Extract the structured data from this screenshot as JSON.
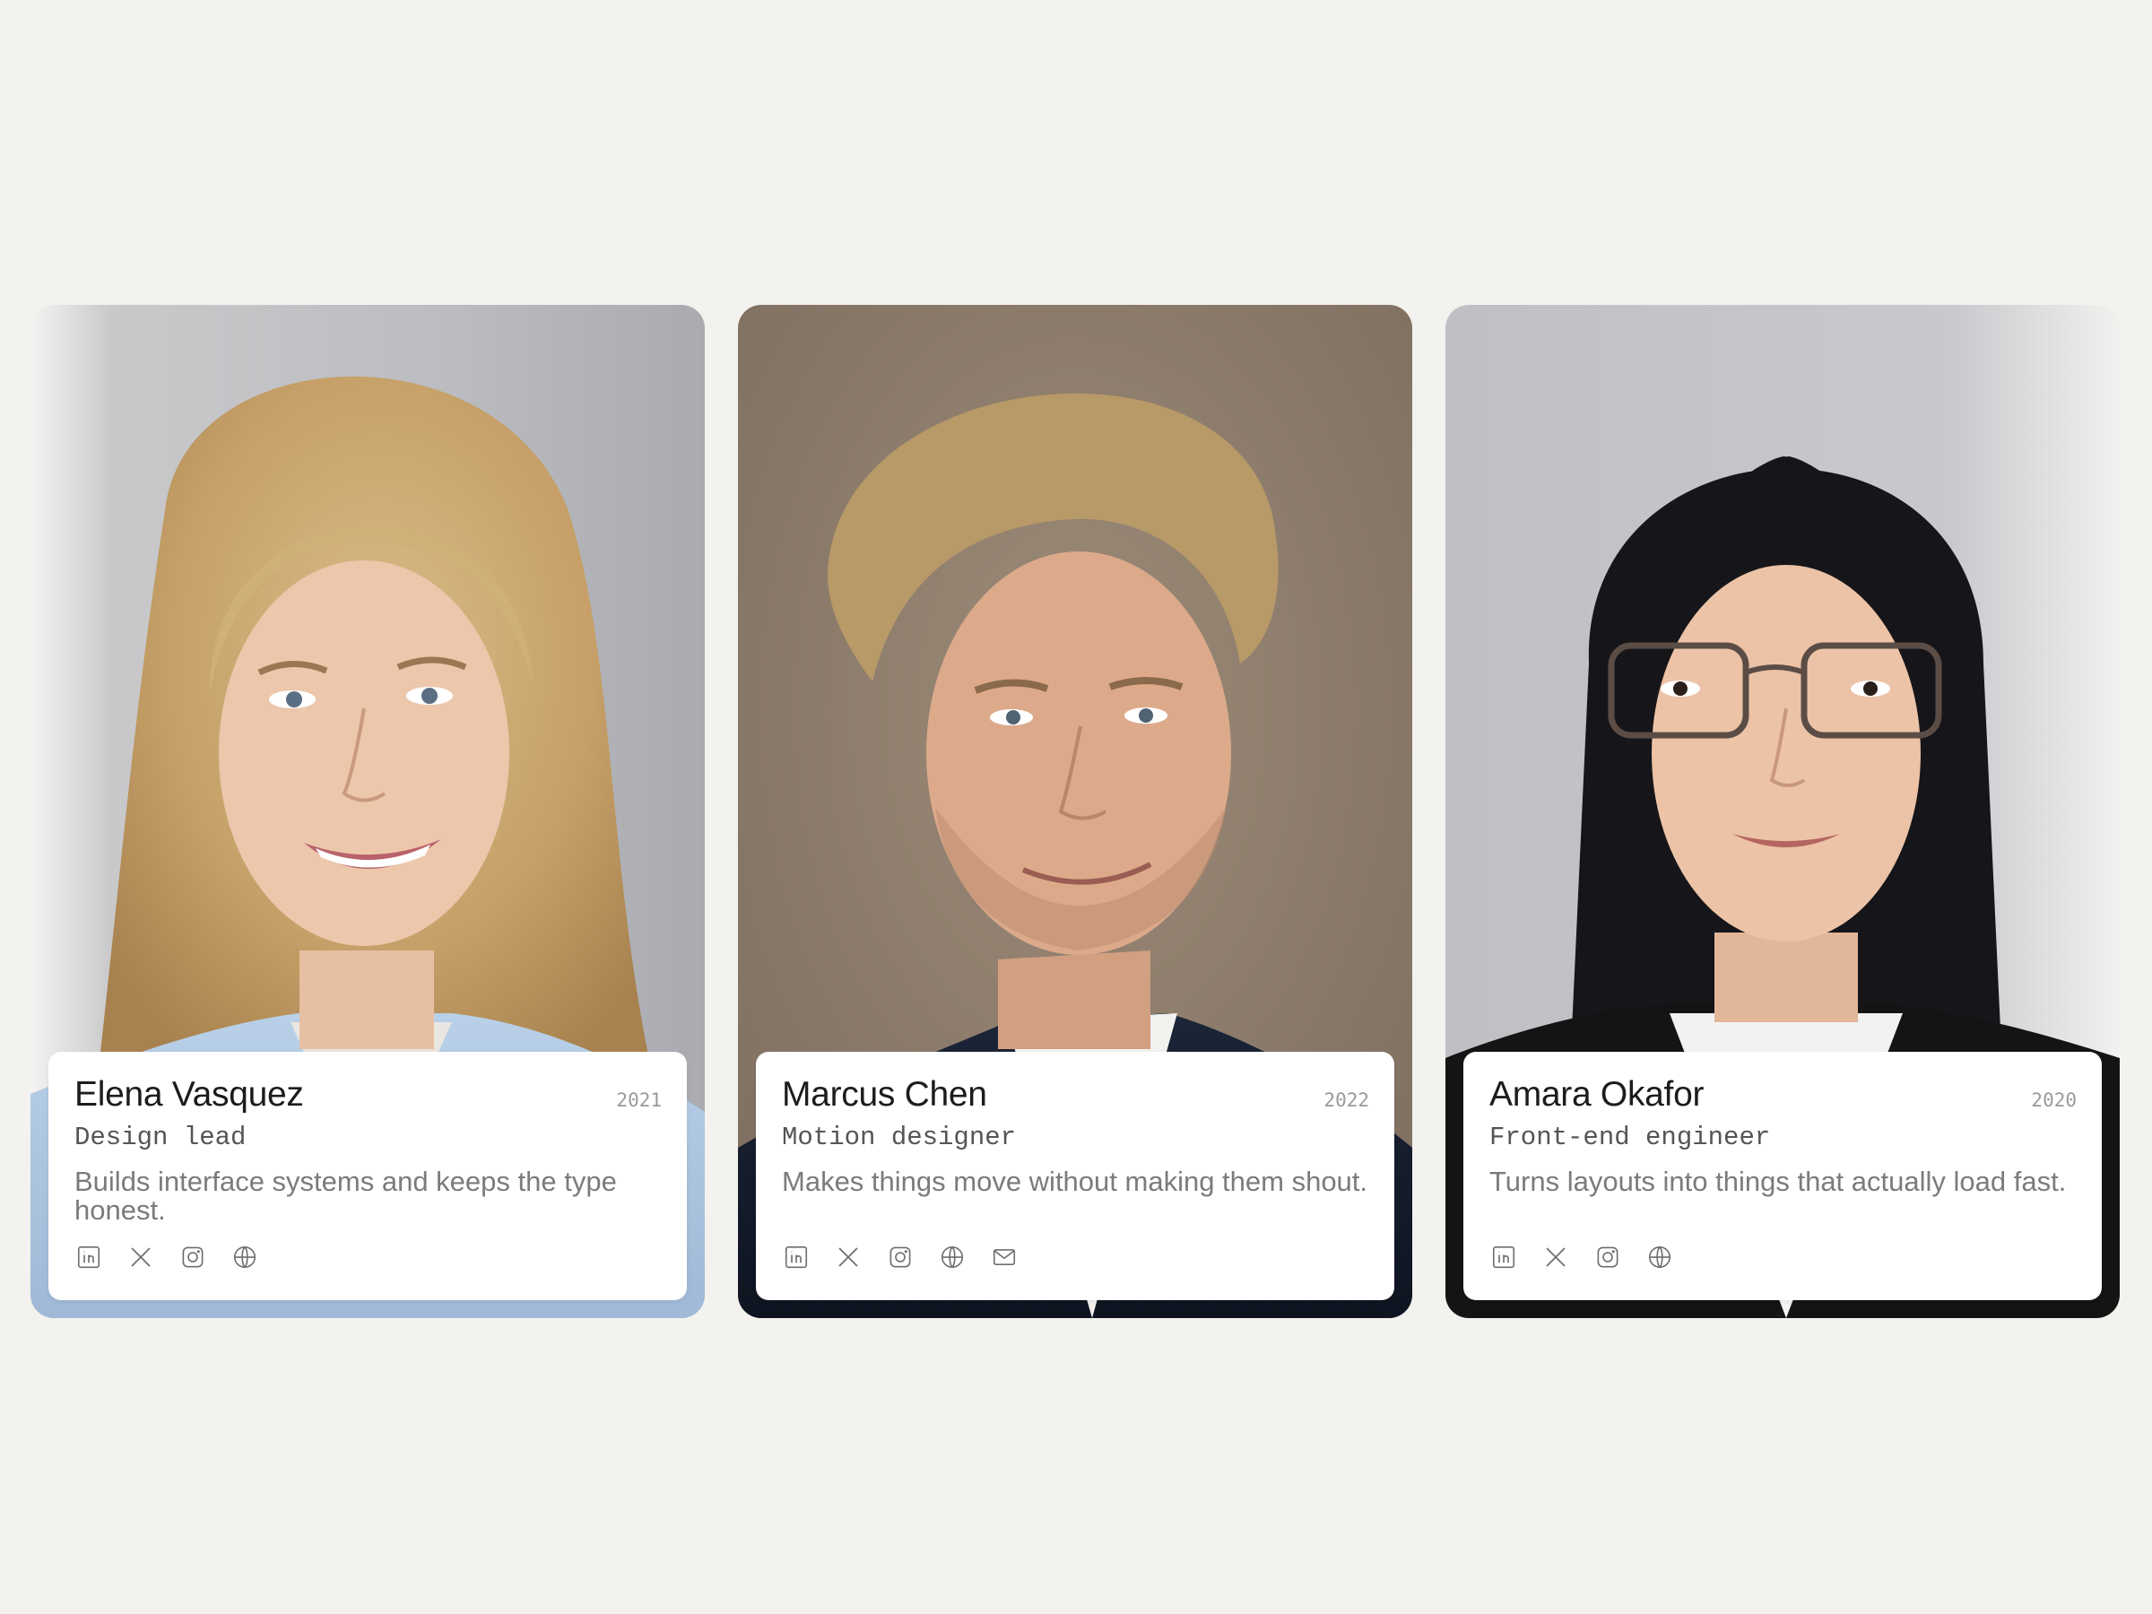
{
  "members": [
    {
      "name": "Elena Vasquez",
      "role": "Design lead",
      "year": "2021",
      "bio": "Builds interface systems and keeps the type honest.",
      "socials": [
        "linkedin-icon",
        "x-icon",
        "instagram-icon",
        "globe-icon"
      ]
    },
    {
      "name": "Marcus Chen",
      "role": "Motion designer",
      "year": "2022",
      "bio": "Makes things move without making them shout.",
      "socials": [
        "linkedin-icon",
        "x-icon",
        "instagram-icon",
        "globe-icon",
        "mail-icon"
      ]
    },
    {
      "name": "Amara Okafor",
      "role": "Front-end engineer",
      "year": "2020",
      "bio": "Turns layouts into things that actually load fast.",
      "socials": [
        "linkedin-icon",
        "x-icon",
        "instagram-icon",
        "globe-icon"
      ]
    }
  ],
  "colors": {
    "page_background": "#f3f2ef",
    "card_panel": "#ffffff",
    "name_text": "#1c1c1c",
    "role_text": "#555555",
    "bio_text": "#7b7b7b",
    "year_text": "#9a9a9a"
  }
}
